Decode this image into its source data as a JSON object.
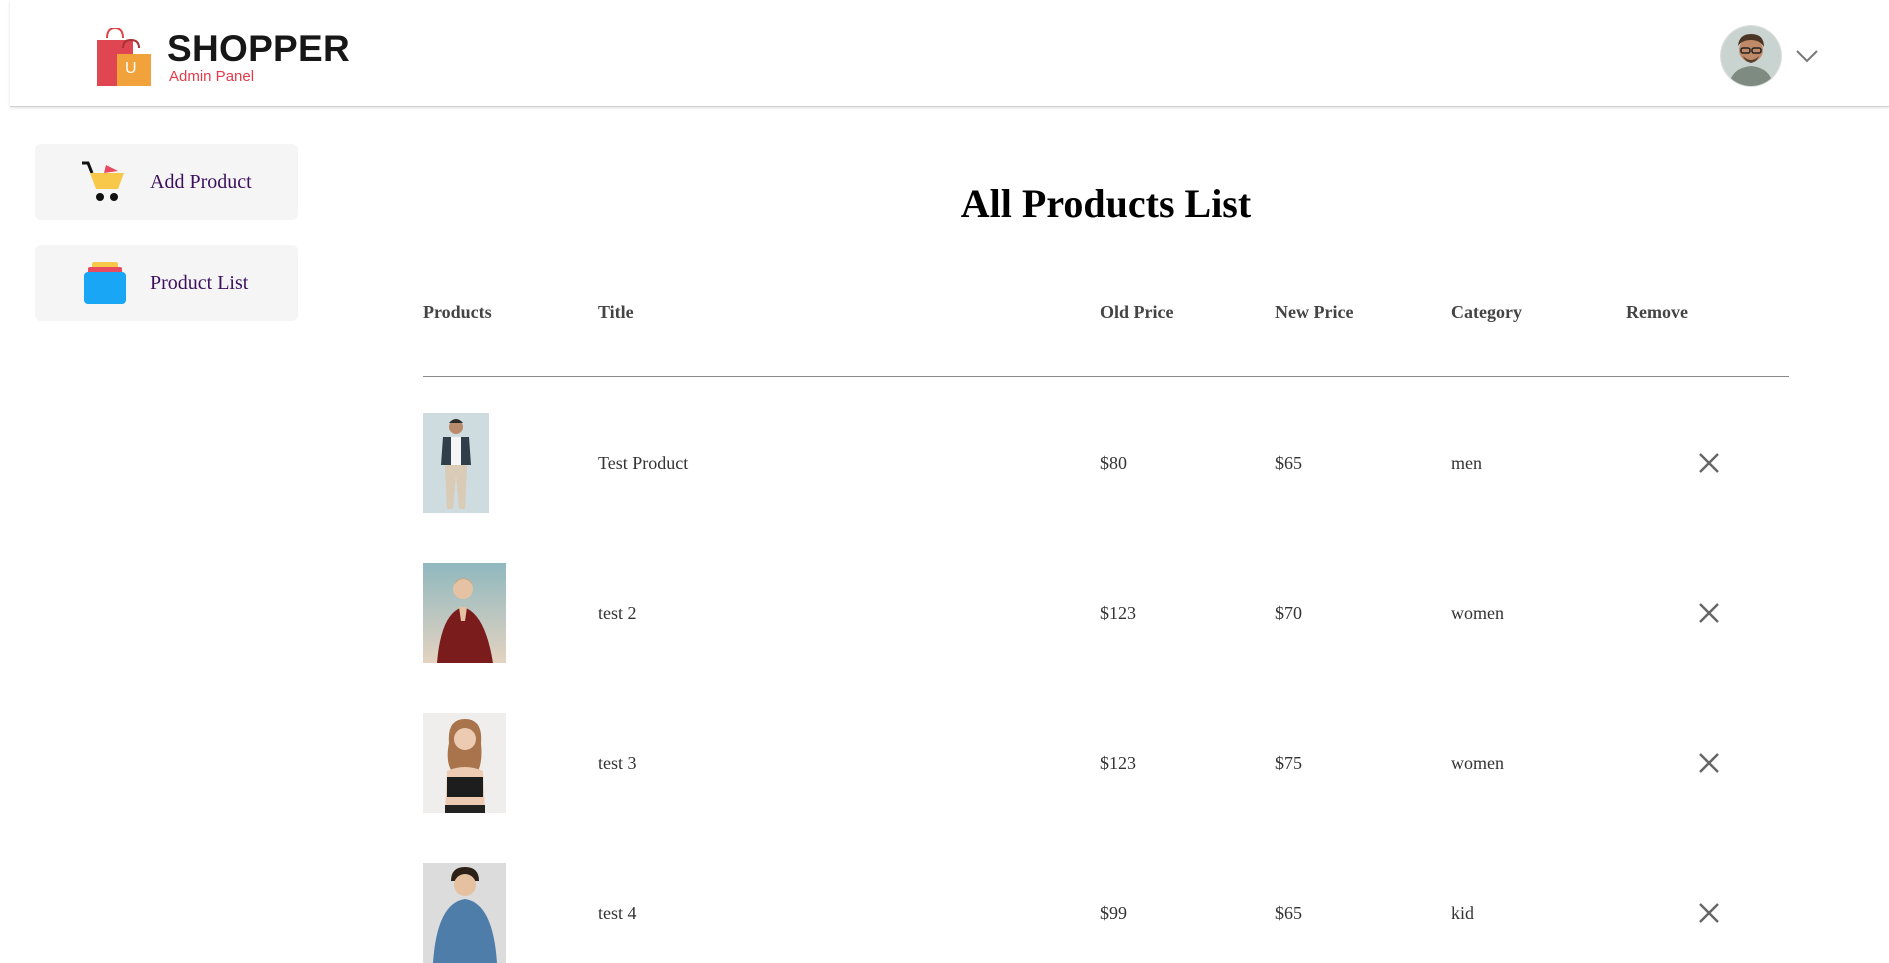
{
  "header": {
    "brand_name": "SHOPPER",
    "brand_subtitle": "Admin Panel",
    "logo_badge": "U",
    "profile_icon": "user-avatar",
    "menu_icon": "chevron-down-icon"
  },
  "sidebar": {
    "items": [
      {
        "label": "Add Product",
        "icon": "cart-icon"
      },
      {
        "label": "Product List",
        "icon": "stack-icon"
      }
    ]
  },
  "main": {
    "title": "All Products List",
    "columns": [
      "Products",
      "Title",
      "Old Price",
      "New Price",
      "Category",
      "Remove"
    ],
    "rows": [
      {
        "title": "Test Product",
        "old_price": "$80",
        "new_price": "$65",
        "category": "men"
      },
      {
        "title": "test 2",
        "old_price": "$123",
        "new_price": "$70",
        "category": "women"
      },
      {
        "title": "test 3",
        "old_price": "$123",
        "new_price": "$75",
        "category": "women"
      },
      {
        "title": "test 4",
        "old_price": "$99",
        "new_price": "$65",
        "category": "kid"
      }
    ]
  },
  "colors": {
    "brand_red": "#e33b4a",
    "sidebar_bg": "#f5f5f5",
    "sidebar_text": "#3b0f5e",
    "cart_yellow": "#f7c84a",
    "stack_blue": "#18a6f5"
  }
}
